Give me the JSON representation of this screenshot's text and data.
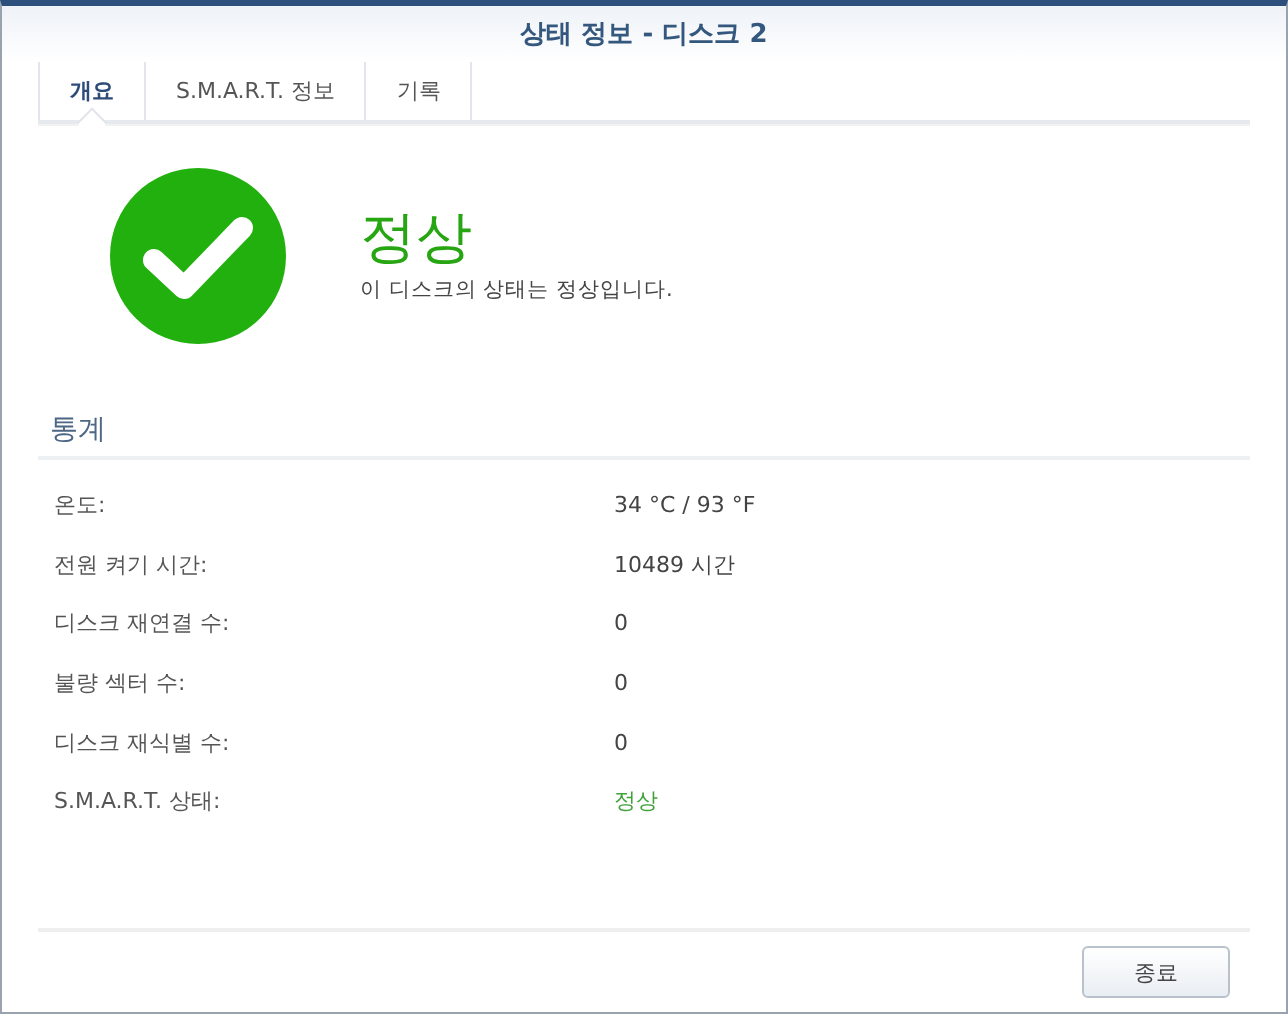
{
  "window": {
    "title": "상태 정보 - 디스크 2"
  },
  "tabs": [
    {
      "label": "개요",
      "selected": true
    },
    {
      "label": "S.M.A.R.T. 정보",
      "selected": false
    },
    {
      "label": "기록",
      "selected": false
    }
  ],
  "status": {
    "kind": "ok",
    "heading": "정상",
    "description": "이 디스크의 상태는 정상입니다."
  },
  "statistics": {
    "title": "통계",
    "rows": [
      {
        "label": "온도:",
        "value": "34 °C / 93 °F",
        "kind": "text"
      },
      {
        "label": "전원 켜기 시간:",
        "value": "10489 시간",
        "kind": "text"
      },
      {
        "label": "디스크 재연결 수:",
        "value": "0",
        "kind": "text"
      },
      {
        "label": "불량 섹터 수:",
        "value": "0",
        "kind": "text"
      },
      {
        "label": "디스크 재식별 수:",
        "value": "0",
        "kind": "text"
      },
      {
        "label": "S.M.A.R.T. 상태:",
        "value": "정상",
        "kind": "status"
      }
    ]
  },
  "buttons": [
    "종료"
  ]
}
